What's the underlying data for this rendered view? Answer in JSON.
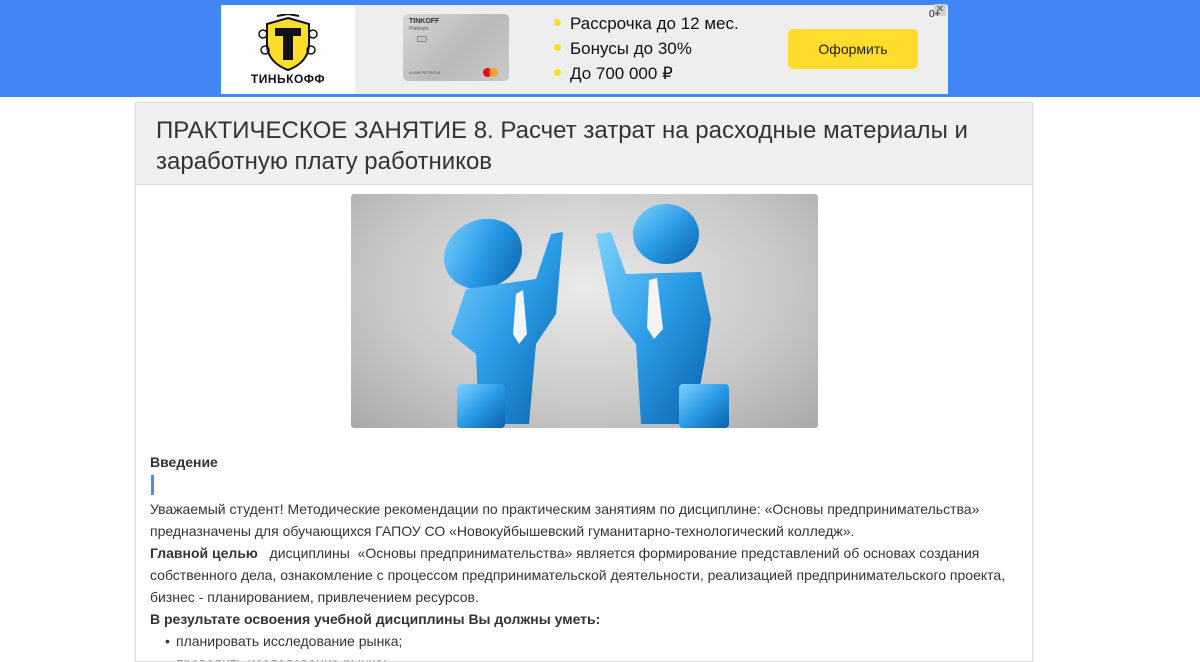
{
  "ad": {
    "brand": "ТИНЬКОФФ",
    "card_brand": "TINKOFF",
    "card_sub": "Platinum",
    "card_name": "ALINA PETROVA",
    "bullets": [
      "Рассрочка до 12 мес.",
      "Бонусы до 30%",
      "До 700 000 ₽"
    ],
    "cta_label": "Оформить",
    "close_label": "✕",
    "age_mark": "0+",
    "accent_color": "#ffdd2d"
  },
  "page": {
    "title": "ПРАКТИЧЕСКОЕ ЗАНЯТИЕ 8. Расчет затрат на расходные материалы и заработную плату работников"
  },
  "hero_image": {
    "alt_icon": "handshake-figures-illustration"
  },
  "content": {
    "intro_heading": "Введение",
    "paragraph_1": "Уважаемый студент! Методические рекомендации по практическим занятиям по дисциплине: «Основы предпринимательства» предназначены для обучающихся ГАПОУ СО «Новокуйбышевский гуманитарно-технологический колледж».",
    "goal_bold": "Главной  целью",
    "goal_text": "   дисциплины  «Основы предпринимательства» является формирование представлений об основах создания собственного дела, ознакомление с процессом предпринимательской деятельности, реализацией предпринимательского проекта, бизнес - планированием, привлечением ресурсов.",
    "skills_heading": "В результате освоения учебной дисциплины Вы должны уметь:",
    "skills": [
      "планировать исследование рынка;",
      "проводить исследование рынка;"
    ]
  },
  "colors": {
    "topbar": "#4285f4",
    "accent_bar": "#4a90d9"
  }
}
